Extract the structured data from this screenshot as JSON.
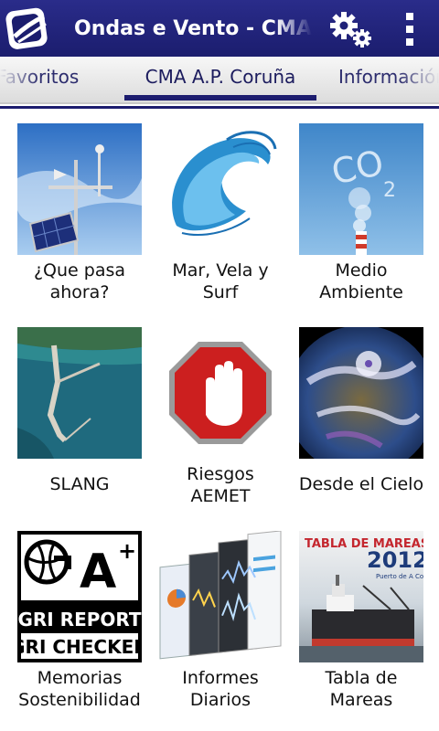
{
  "app": {
    "title": "Ondas e Vento - CMA A.P. Coruña"
  },
  "tabs": [
    {
      "label": "Favoritos"
    },
    {
      "label": "CMA A.P. Coruña"
    },
    {
      "label": "Información"
    }
  ],
  "active_tab": 1,
  "colors": {
    "actionbar": "#1b1d6e",
    "tab_indicator": "#1c1c6e"
  },
  "tiles": [
    {
      "label": "¿Que pasa ahora?",
      "label_l1": "¿Que pasa",
      "label_l2": "ahora?",
      "icon": "weather-station-icon"
    },
    {
      "label": "Mar, Vela y Surf",
      "label_l1": "Mar, Vela y",
      "label_l2": "Surf",
      "icon": "wave-icon"
    },
    {
      "label": "Medio Ambiente",
      "label_l1": "Medio",
      "label_l2": "Ambiente",
      "icon": "co2-chimney-icon"
    },
    {
      "label": "SLANG",
      "label_l1": "SLANG",
      "icon": "breakwater-aerial-icon"
    },
    {
      "label": "Riesgos AEMET",
      "label_l1": "Riesgos",
      "label_l2": "AEMET",
      "icon": "stop-hand-icon"
    },
    {
      "label": "Desde el Cielo",
      "label_l1": "Desde el Cielo",
      "icon": "satellite-storm-icon"
    },
    {
      "label": "Memorias Sostenibilidad",
      "label_l1": "Memorias",
      "label_l2": "Sostenibilidad",
      "icon": "gri-report-icon",
      "badge": {
        "grade": "A",
        "plus": "+",
        "line1": "GRI REPORT",
        "line2": "GRI CHECKED"
      }
    },
    {
      "label": "Informes Diarios",
      "label_l1": "Informes",
      "label_l2": "Diarios",
      "icon": "daily-reports-icon"
    },
    {
      "label": "Tabla de Mareas",
      "label_l1": "Tabla de",
      "label_l2": "Mareas",
      "icon": "tide-table-cover-icon",
      "cover": {
        "title": "TABLA DE MAREAS",
        "year": "2012",
        "publisher": "Puerto de A Coruña"
      }
    }
  ]
}
